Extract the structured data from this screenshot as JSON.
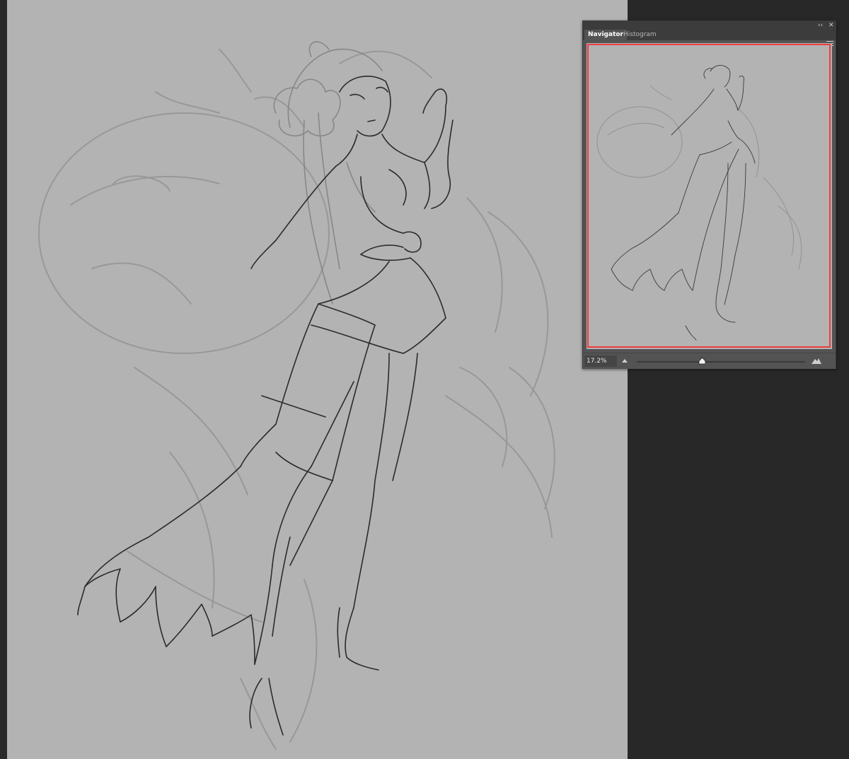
{
  "navigator": {
    "tabs": [
      {
        "label": "Navigator",
        "active": true
      },
      {
        "label": "Histogram",
        "active": false
      }
    ],
    "topbar": {
      "collapse_icon": "double-chevron-left-icon",
      "close_icon": "close-icon"
    },
    "zoom_value": "17.2%",
    "zoom_slider_fraction": 0.39,
    "menu_icon": "hamburger-menu-icon",
    "zoom_out_icon": "small-mountain-icon",
    "zoom_in_icon": "large-mountain-icon"
  },
  "colors": {
    "canvas": "#b3b3b3",
    "pasteboard": "#282828",
    "panel": "#535353",
    "view_box": "#ee3d3d"
  }
}
